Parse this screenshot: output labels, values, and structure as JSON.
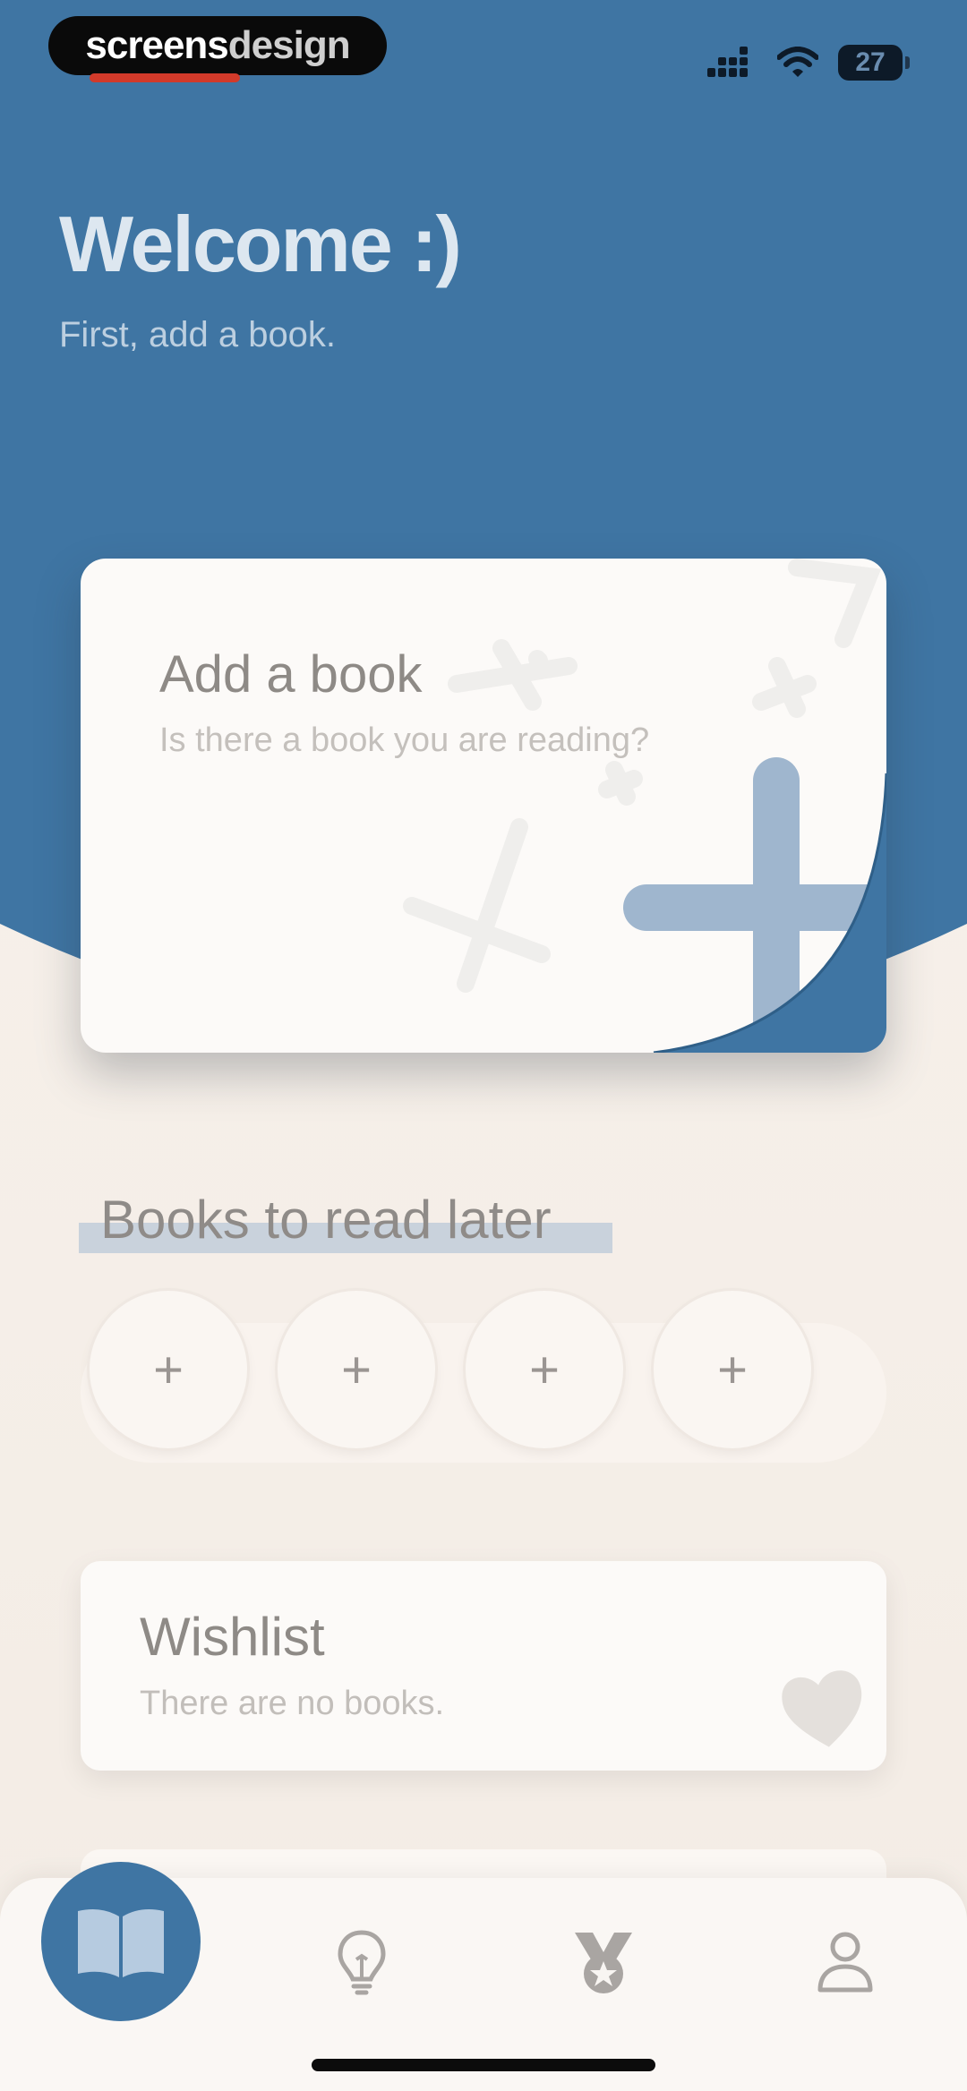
{
  "watermark": {
    "part1": "screens",
    "part2": "design"
  },
  "status_bar": {
    "battery_level": "27",
    "icons": [
      "cellular-signal-icon",
      "wifi-icon",
      "battery-icon"
    ]
  },
  "header": {
    "title": "Welcome :)",
    "subtitle": "First, add a book."
  },
  "add_book_card": {
    "title": "Add a book",
    "subtitle": "Is there a book you are reading?",
    "icon": "plus-icon"
  },
  "read_later": {
    "title": "Books to read later",
    "slots": [
      "+",
      "+",
      "+",
      "+"
    ]
  },
  "wishlist": {
    "title": "Wishlist",
    "subtitle": "There are no books.",
    "icon": "heart-icon"
  },
  "tab_bar": {
    "tabs": [
      {
        "icon": "open-book-icon",
        "active": true
      },
      {
        "icon": "lightbulb-icon",
        "active": false
      },
      {
        "icon": "medal-icon",
        "active": false
      },
      {
        "icon": "person-icon",
        "active": false
      }
    ]
  },
  "colors": {
    "header_blue": "#3f75a3",
    "background_cream": "#f6efe8",
    "card_white": "#fcfaf8",
    "accent_light_blue": "#9fb6ce",
    "text_gray": "#8e8a86"
  }
}
